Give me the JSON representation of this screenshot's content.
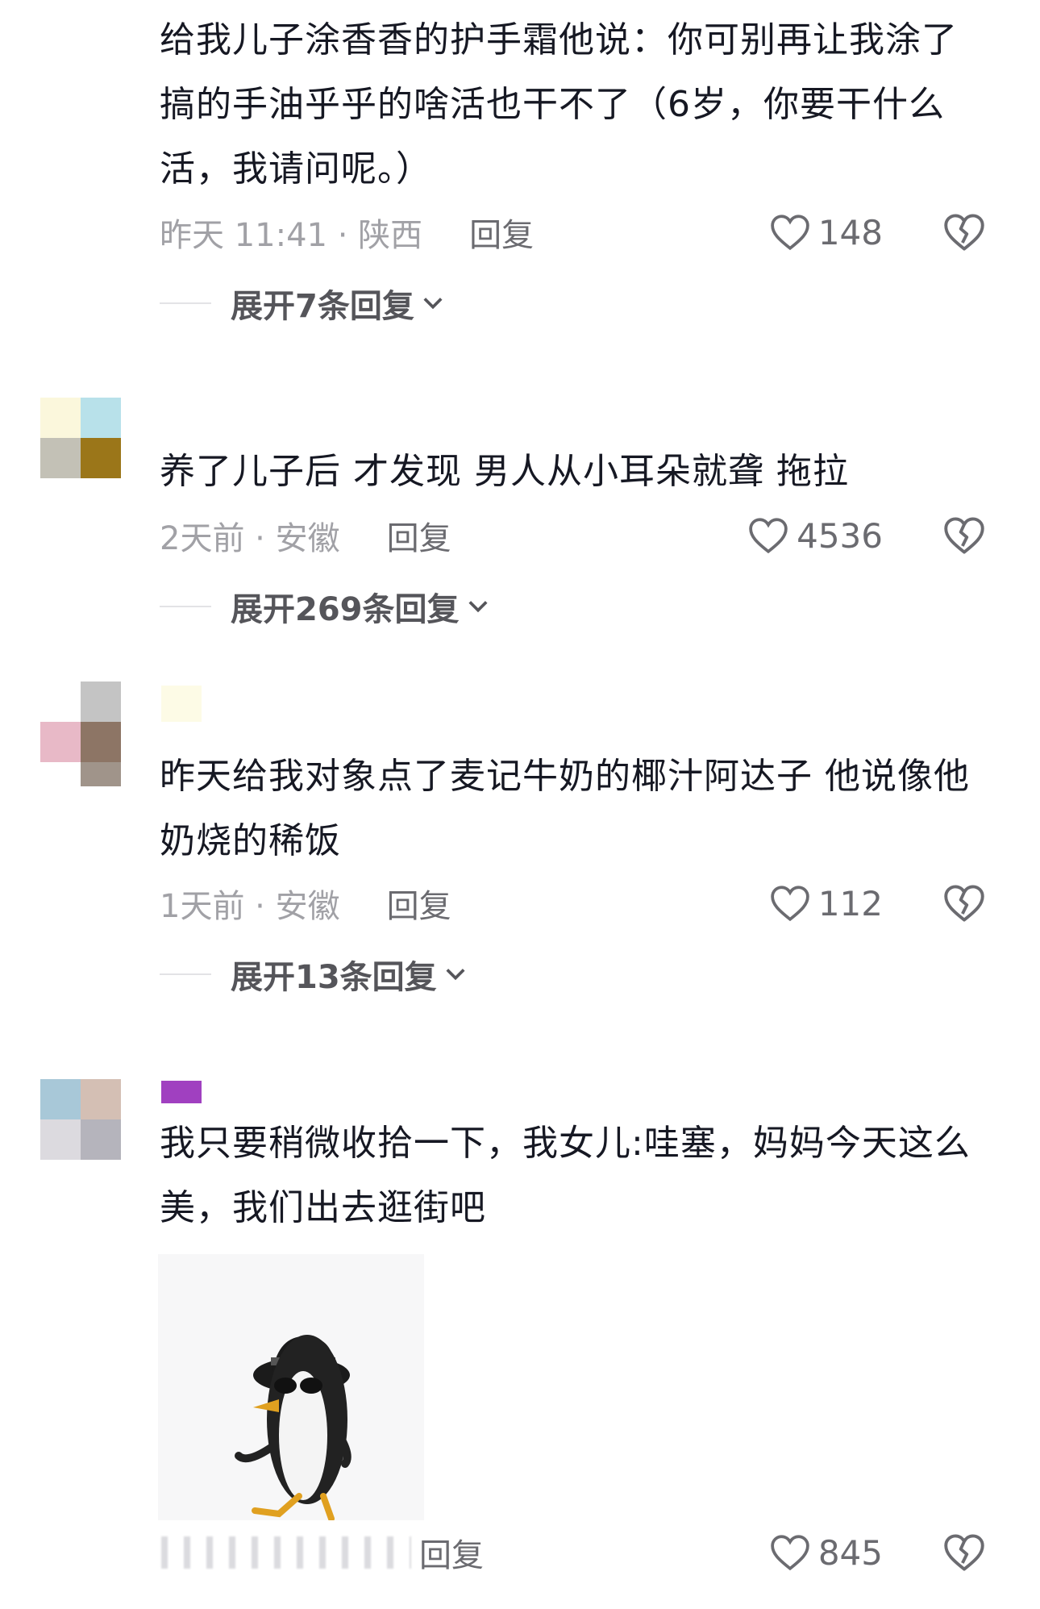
{
  "comments": [
    {
      "text": "给我儿子涂香香的护手霜他说：你可别再让我涂了搞的手油乎乎的啥活也干不了（6岁，你要干什么活，我请问呢。）",
      "time_location": "昨天 11:41 · 陕西",
      "reply_label": "回复",
      "likes": "148",
      "expand_label": "展开7条回复"
    },
    {
      "text": "养了儿子后 才发现 男人从小耳朵就聋 拖拉",
      "time_location": "2天前 · 安徽",
      "reply_label": "回复",
      "likes": "4536",
      "expand_label": "展开269条回复"
    },
    {
      "text": "昨天给我对象点了麦记牛奶的椰汁阿达子 他说像他奶烧的稀饭",
      "time_location": "1天前 · 安徽",
      "reply_label": "回复",
      "likes": "112",
      "expand_label": "展开13条回复"
    },
    {
      "text": "我只要稍微收拾一下，我女儿:哇塞，妈妈今天这么美，我们出去逛街吧",
      "time_location": "",
      "reply_label": "回复",
      "likes": "845",
      "image": "penguin-sticker"
    }
  ],
  "icons": {
    "like": "heart-outline-icon",
    "dislike": "broken-heart-icon",
    "expand": "chevron-down-icon"
  },
  "colors": {
    "text": "#161823",
    "meta": "#a1a1a6",
    "action": "#6b6b70"
  }
}
